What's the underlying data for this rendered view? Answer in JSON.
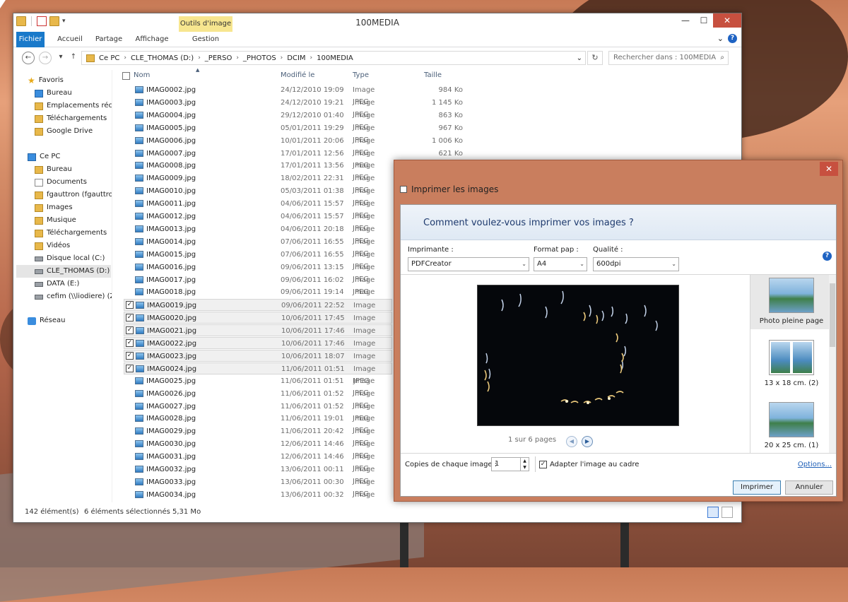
{
  "explorer": {
    "ribbon_context_tab": "Outils d'image",
    "window_title": "100MEDIA",
    "win_minimize": "—",
    "win_maximize": "☐",
    "win_close": "✕",
    "tabs": {
      "file": "Fichier",
      "home": "Accueil",
      "share": "Partage",
      "view": "Affichage",
      "manage": "Gestion"
    },
    "ribbon_expand": "⌄",
    "help": "?",
    "nav": {
      "back": "←",
      "forward": "→",
      "recent": "▾",
      "up": "↑"
    },
    "address": [
      "Ce PC",
      "CLE_THOMAS (D:)",
      "_PERSO",
      "_PHOTOS",
      "DCIM",
      "100MEDIA"
    ],
    "address_sep": "›",
    "address_dropdown": "⌄",
    "refresh": "↻",
    "search_placeholder": "Rechercher dans : 100MEDIA",
    "search_icon": "⌕",
    "navpane": {
      "favorites": "Favoris",
      "favorites_items": [
        "Bureau",
        "Emplacements récents",
        "Téléchargements",
        "Google Drive"
      ],
      "thispc": "Ce PC",
      "thispc_items": [
        "Bureau",
        "Documents",
        "fgauttron (fgauttron",
        "Images",
        "Musique",
        "Téléchargements",
        "Vidéos",
        "Disque local (C:)",
        "CLE_THOMAS (D:)",
        "DATA (E:)",
        "cefim (\\\\liodiere) (Z:)"
      ],
      "network": "Réseau"
    },
    "columns": {
      "name": "Nom",
      "modified": "Modifié le",
      "type": "Type",
      "size": "Taille"
    },
    "sort_arrow": "▲",
    "files": [
      {
        "name": "IMAG0002.jpg",
        "date": "24/12/2010 19:09",
        "type": "Image JPEG",
        "size": "984 Ko",
        "sel": false
      },
      {
        "name": "IMAG0003.jpg",
        "date": "24/12/2010 19:21",
        "type": "Image JPEG",
        "size": "1 145 Ko",
        "sel": false
      },
      {
        "name": "IMAG0004.jpg",
        "date": "29/12/2010 01:40",
        "type": "Image JPEG",
        "size": "863 Ko",
        "sel": false
      },
      {
        "name": "IMAG0005.jpg",
        "date": "05/01/2011 19:29",
        "type": "Image JPEG",
        "size": "967 Ko",
        "sel": false
      },
      {
        "name": "IMAG0006.jpg",
        "date": "10/01/2011 20:06",
        "type": "Image JPEG",
        "size": "1 006 Ko",
        "sel": false
      },
      {
        "name": "IMAG0007.jpg",
        "date": "17/01/2011 12:56",
        "type": "Image JPEG",
        "size": "621 Ko",
        "sel": false
      },
      {
        "name": "IMAG0008.jpg",
        "date": "17/01/2011 13:56",
        "type": "Image JPEG",
        "size": "",
        "sel": false
      },
      {
        "name": "IMAG0009.jpg",
        "date": "18/02/2011 22:31",
        "type": "Image JPEG",
        "size": "",
        "sel": false
      },
      {
        "name": "IMAG0010.jpg",
        "date": "05/03/2011 01:38",
        "type": "Image JPEG",
        "size": "",
        "sel": false
      },
      {
        "name": "IMAG0011.jpg",
        "date": "04/06/2011 15:57",
        "type": "Image JPEG",
        "size": "",
        "sel": false
      },
      {
        "name": "IMAG0012.jpg",
        "date": "04/06/2011 15:57",
        "type": "Image JPEG",
        "size": "",
        "sel": false
      },
      {
        "name": "IMAG0013.jpg",
        "date": "04/06/2011 20:18",
        "type": "Image JPEG",
        "size": "",
        "sel": false
      },
      {
        "name": "IMAG0014.jpg",
        "date": "07/06/2011 16:55",
        "type": "Image JPEG",
        "size": "",
        "sel": false
      },
      {
        "name": "IMAG0015.jpg",
        "date": "07/06/2011 16:55",
        "type": "Image JPEG",
        "size": "",
        "sel": false
      },
      {
        "name": "IMAG0016.jpg",
        "date": "09/06/2011 13:15",
        "type": "Image JPEG",
        "size": "",
        "sel": false
      },
      {
        "name": "IMAG0017.jpg",
        "date": "09/06/2011 16:02",
        "type": "Image JPEG",
        "size": "",
        "sel": false
      },
      {
        "name": "IMAG0018.jpg",
        "date": "09/06/2011 19:14",
        "type": "Image JPEG",
        "size": "",
        "sel": false
      },
      {
        "name": "IMAG0019.jpg",
        "date": "09/06/2011 22:52",
        "type": "Image JPEG",
        "size": "",
        "sel": true
      },
      {
        "name": "IMAG0020.jpg",
        "date": "10/06/2011 17:45",
        "type": "Image JPEG",
        "size": "",
        "sel": true
      },
      {
        "name": "IMAG0021.jpg",
        "date": "10/06/2011 17:46",
        "type": "Image JPEG",
        "size": "",
        "sel": true
      },
      {
        "name": "IMAG0022.jpg",
        "date": "10/06/2011 17:46",
        "type": "Image JPEG",
        "size": "",
        "sel": true
      },
      {
        "name": "IMAG0023.jpg",
        "date": "10/06/2011 18:07",
        "type": "Image JPEG",
        "size": "",
        "sel": true
      },
      {
        "name": "IMAG0024.jpg",
        "date": "11/06/2011 01:51",
        "type": "Image JPEG",
        "size": "",
        "sel": true
      },
      {
        "name": "IMAG0025.jpg",
        "date": "11/06/2011 01:51",
        "type": "Image JPEG",
        "size": "",
        "sel": false
      },
      {
        "name": "IMAG0026.jpg",
        "date": "11/06/2011 01:52",
        "type": "Image JPEG",
        "size": "",
        "sel": false
      },
      {
        "name": "IMAG0027.jpg",
        "date": "11/06/2011 01:52",
        "type": "Image JPEG",
        "size": "",
        "sel": false
      },
      {
        "name": "IMAG0028.jpg",
        "date": "11/06/2011 19:01",
        "type": "Image JPEG",
        "size": "",
        "sel": false
      },
      {
        "name": "IMAG0029.jpg",
        "date": "11/06/2011 20:42",
        "type": "Image JPEG",
        "size": "",
        "sel": false
      },
      {
        "name": "IMAG0030.jpg",
        "date": "12/06/2011 14:46",
        "type": "Image JPEG",
        "size": "",
        "sel": false
      },
      {
        "name": "IMAG0031.jpg",
        "date": "12/06/2011 14:46",
        "type": "Image JPEG",
        "size": "",
        "sel": false
      },
      {
        "name": "IMAG0032.jpg",
        "date": "13/06/2011 00:11",
        "type": "Image JPEG",
        "size": "",
        "sel": false
      },
      {
        "name": "IMAG0033.jpg",
        "date": "13/06/2011 00:30",
        "type": "Image JPEG",
        "size": "",
        "sel": false
      },
      {
        "name": "IMAG0034.jpg",
        "date": "13/06/2011 00:32",
        "type": "Image JPEG",
        "size": "",
        "sel": false
      }
    ],
    "checkmark": "✓",
    "status_count": "142 élément(s)",
    "status_selected": "6 éléments sélectionnés  5,31 Mo"
  },
  "print": {
    "close": "✕",
    "title": "Imprimer les images",
    "question": "Comment voulez-vous imprimer vos images ?",
    "printer_label": "Imprimante :",
    "printer_value": "PDFCreator",
    "paper_label": "Format pap :",
    "paper_value": "A4",
    "quality_label": "Qualité :",
    "quality_value": "600dpi",
    "select_arrow": "⌄",
    "help": "?",
    "page_info": "1 sur 6 pages",
    "prev": "◀",
    "next": "▶",
    "layouts": [
      "Photo pleine page",
      "13 x 18 cm. (2)",
      "20 x 25 cm. (1)"
    ],
    "copies_label": "Copies de chaque image :",
    "copies_value": "1",
    "spin_up": "▲",
    "spin_down": "▼",
    "fit_label": "Adapter l'image au cadre",
    "fit_check": "✓",
    "options": "Options...",
    "print_button": "Imprimer",
    "cancel_button": "Annuler"
  }
}
